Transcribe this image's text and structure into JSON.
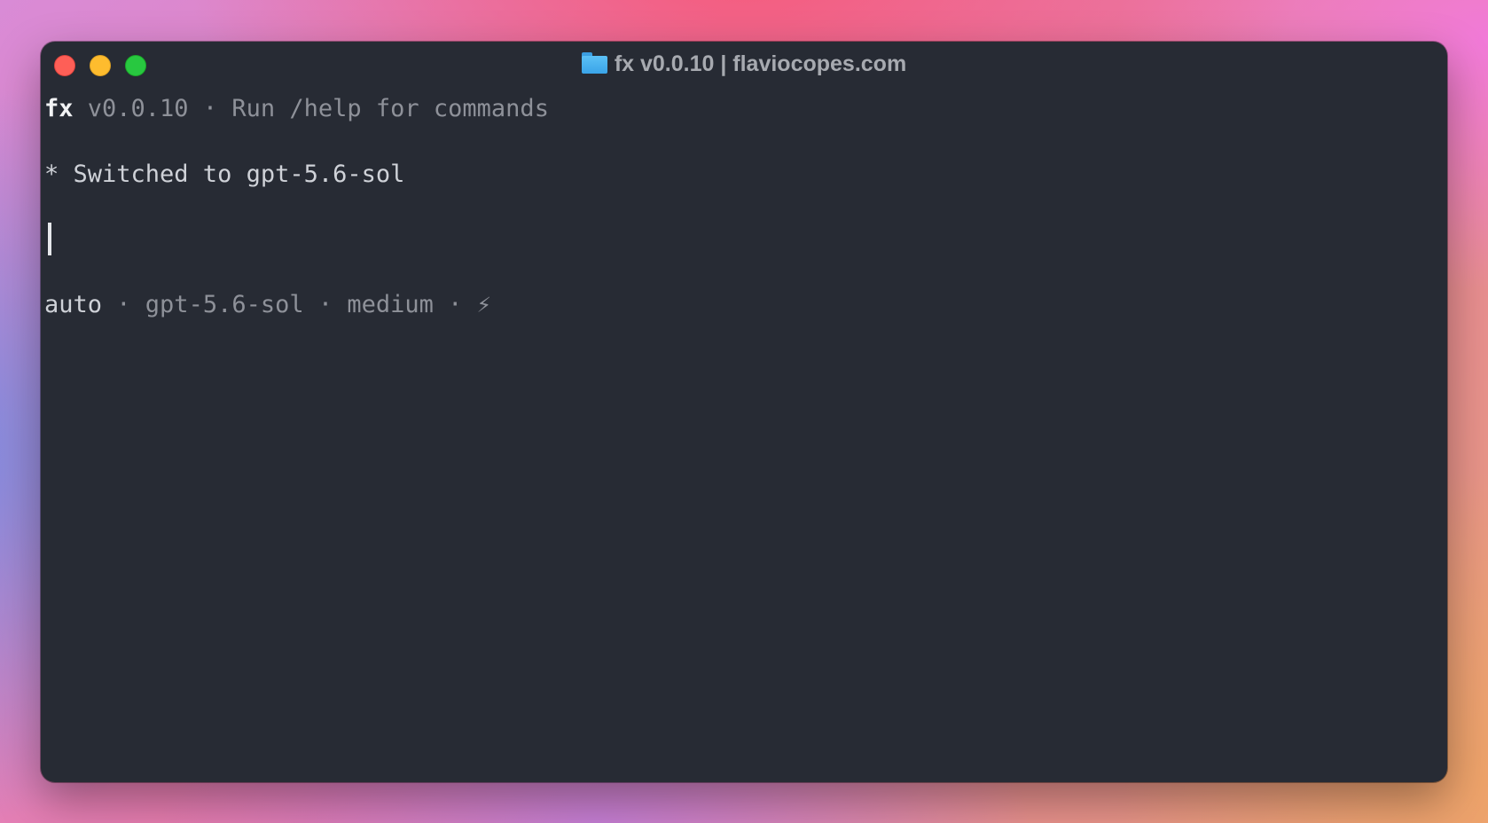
{
  "window": {
    "title": "fx v0.0.10 | flaviocopes.com",
    "title_icon": "folder-icon"
  },
  "terminal": {
    "header": {
      "app": "fx",
      "info": " v0.0.10 · Run /help for commands"
    },
    "message": "* Switched to gpt-5.6-sol",
    "prompt_value": "",
    "status": {
      "mode": "auto",
      "rest": " · gpt-5.6-sol · medium · ",
      "bolt": "⚡︎"
    }
  },
  "colors": {
    "window_bg": "#272b34",
    "close": "#fe5f57",
    "minimize": "#febc2e",
    "maximize": "#28c840",
    "dim_text": "#8e9199",
    "bright_text": "#f2f3f5"
  }
}
